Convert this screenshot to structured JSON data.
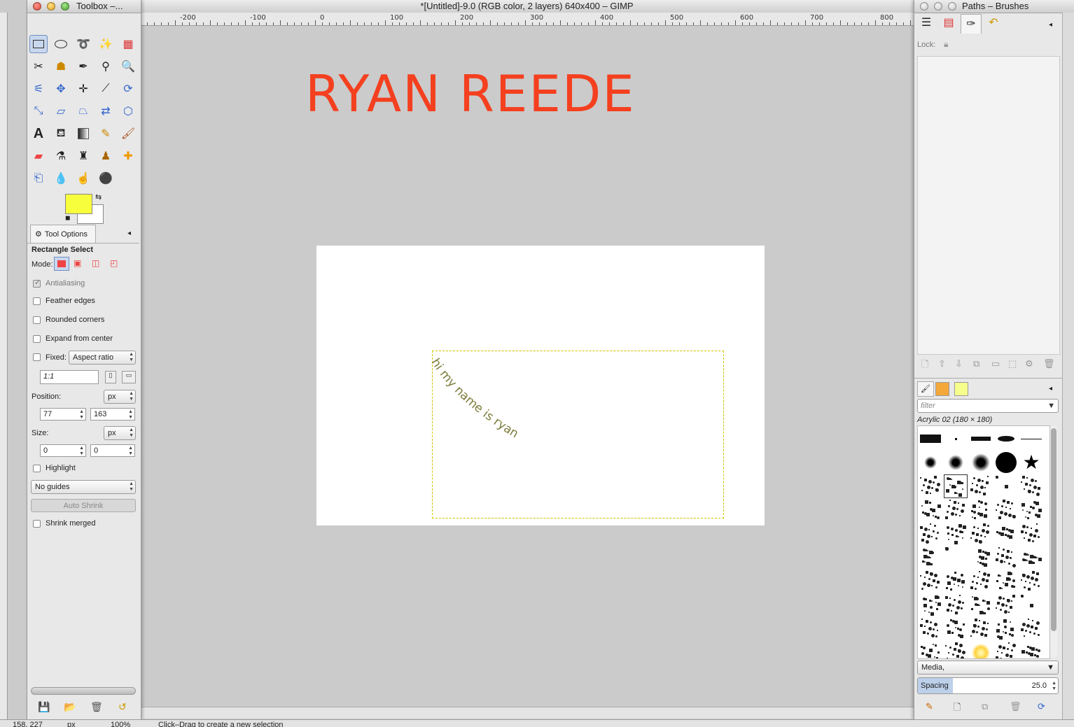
{
  "window": {
    "title": "*[Untitled]-9.0 (RGB color, 2 layers) 640x400 – GIMP"
  },
  "toolbox": {
    "title": "Toolbox –...",
    "tool_options_tab": "Tool Options",
    "tool_name": "Rectangle Select",
    "mode_label": "Mode:",
    "antialiasing_label": "Antialiasing",
    "feather_label": "Feather edges",
    "rounded_label": "Rounded corners",
    "expand_label": "Expand from center",
    "fixed_label": "Fixed:",
    "fixed_value": "Aspect ratio",
    "ratio_value": "1:1",
    "position_label": "Position:",
    "position_unit": "px",
    "position_x": "77",
    "position_y": "163",
    "size_label": "Size:",
    "size_unit": "px",
    "size_w": "0",
    "size_h": "0",
    "highlight_label": "Highlight",
    "guides_value": "No guides",
    "auto_shrink_label": "Auto Shrink",
    "shrink_merged_label": "Shrink merged",
    "fg_color": "#f7ff3c",
    "bg_color": "#ffffff"
  },
  "ruler": {
    "labels": [
      "-200",
      "-100",
      "0",
      "100",
      "200",
      "300",
      "400",
      "500",
      "600",
      "700",
      "800"
    ]
  },
  "canvas": {
    "heading_text": "RYAN REEDE",
    "heading_color": "#f4401f",
    "curved_text": "hi my name is ryan",
    "curved_text_color": "#7c7c3c"
  },
  "dock": {
    "title": "Paths – Brushes",
    "lock_label": "Lock:",
    "filter_placeholder": "filter",
    "brush_name": "Acrylic 02 (180 × 180)",
    "tag_value": "Media,",
    "spacing_label": "Spacing",
    "spacing_value": "25.0"
  },
  "status": {
    "coords": "158, 227",
    "unit": "px",
    "zoom": "100%",
    "message": "Click–Drag to create a new selection"
  }
}
